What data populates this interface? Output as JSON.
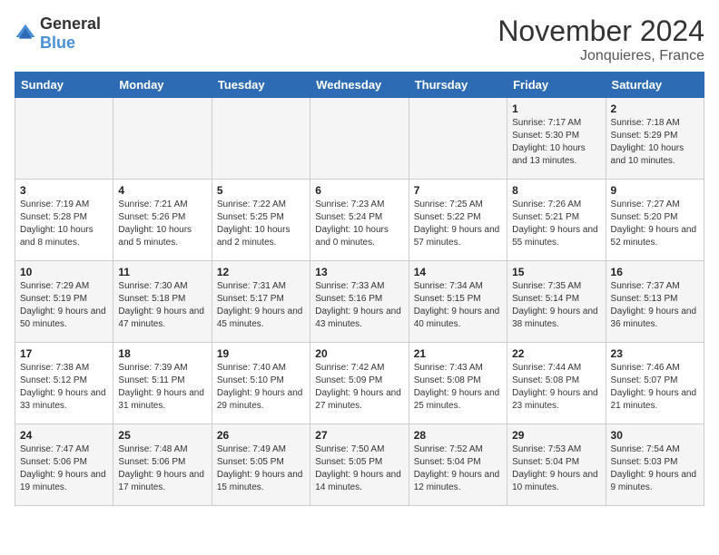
{
  "logo": {
    "general": "General",
    "blue": "Blue"
  },
  "header": {
    "month": "November 2024",
    "location": "Jonquieres, France"
  },
  "weekdays": [
    "Sunday",
    "Monday",
    "Tuesday",
    "Wednesday",
    "Thursday",
    "Friday",
    "Saturday"
  ],
  "weeks": [
    [
      {
        "day": "",
        "info": ""
      },
      {
        "day": "",
        "info": ""
      },
      {
        "day": "",
        "info": ""
      },
      {
        "day": "",
        "info": ""
      },
      {
        "day": "",
        "info": ""
      },
      {
        "day": "1",
        "info": "Sunrise: 7:17 AM\nSunset: 5:30 PM\nDaylight: 10 hours and 13 minutes."
      },
      {
        "day": "2",
        "info": "Sunrise: 7:18 AM\nSunset: 5:29 PM\nDaylight: 10 hours and 10 minutes."
      }
    ],
    [
      {
        "day": "3",
        "info": "Sunrise: 7:19 AM\nSunset: 5:28 PM\nDaylight: 10 hours and 8 minutes."
      },
      {
        "day": "4",
        "info": "Sunrise: 7:21 AM\nSunset: 5:26 PM\nDaylight: 10 hours and 5 minutes."
      },
      {
        "day": "5",
        "info": "Sunrise: 7:22 AM\nSunset: 5:25 PM\nDaylight: 10 hours and 2 minutes."
      },
      {
        "day": "6",
        "info": "Sunrise: 7:23 AM\nSunset: 5:24 PM\nDaylight: 10 hours and 0 minutes."
      },
      {
        "day": "7",
        "info": "Sunrise: 7:25 AM\nSunset: 5:22 PM\nDaylight: 9 hours and 57 minutes."
      },
      {
        "day": "8",
        "info": "Sunrise: 7:26 AM\nSunset: 5:21 PM\nDaylight: 9 hours and 55 minutes."
      },
      {
        "day": "9",
        "info": "Sunrise: 7:27 AM\nSunset: 5:20 PM\nDaylight: 9 hours and 52 minutes."
      }
    ],
    [
      {
        "day": "10",
        "info": "Sunrise: 7:29 AM\nSunset: 5:19 PM\nDaylight: 9 hours and 50 minutes."
      },
      {
        "day": "11",
        "info": "Sunrise: 7:30 AM\nSunset: 5:18 PM\nDaylight: 9 hours and 47 minutes."
      },
      {
        "day": "12",
        "info": "Sunrise: 7:31 AM\nSunset: 5:17 PM\nDaylight: 9 hours and 45 minutes."
      },
      {
        "day": "13",
        "info": "Sunrise: 7:33 AM\nSunset: 5:16 PM\nDaylight: 9 hours and 43 minutes."
      },
      {
        "day": "14",
        "info": "Sunrise: 7:34 AM\nSunset: 5:15 PM\nDaylight: 9 hours and 40 minutes."
      },
      {
        "day": "15",
        "info": "Sunrise: 7:35 AM\nSunset: 5:14 PM\nDaylight: 9 hours and 38 minutes."
      },
      {
        "day": "16",
        "info": "Sunrise: 7:37 AM\nSunset: 5:13 PM\nDaylight: 9 hours and 36 minutes."
      }
    ],
    [
      {
        "day": "17",
        "info": "Sunrise: 7:38 AM\nSunset: 5:12 PM\nDaylight: 9 hours and 33 minutes."
      },
      {
        "day": "18",
        "info": "Sunrise: 7:39 AM\nSunset: 5:11 PM\nDaylight: 9 hours and 31 minutes."
      },
      {
        "day": "19",
        "info": "Sunrise: 7:40 AM\nSunset: 5:10 PM\nDaylight: 9 hours and 29 minutes."
      },
      {
        "day": "20",
        "info": "Sunrise: 7:42 AM\nSunset: 5:09 PM\nDaylight: 9 hours and 27 minutes."
      },
      {
        "day": "21",
        "info": "Sunrise: 7:43 AM\nSunset: 5:08 PM\nDaylight: 9 hours and 25 minutes."
      },
      {
        "day": "22",
        "info": "Sunrise: 7:44 AM\nSunset: 5:08 PM\nDaylight: 9 hours and 23 minutes."
      },
      {
        "day": "23",
        "info": "Sunrise: 7:46 AM\nSunset: 5:07 PM\nDaylight: 9 hours and 21 minutes."
      }
    ],
    [
      {
        "day": "24",
        "info": "Sunrise: 7:47 AM\nSunset: 5:06 PM\nDaylight: 9 hours and 19 minutes."
      },
      {
        "day": "25",
        "info": "Sunrise: 7:48 AM\nSunset: 5:06 PM\nDaylight: 9 hours and 17 minutes."
      },
      {
        "day": "26",
        "info": "Sunrise: 7:49 AM\nSunset: 5:05 PM\nDaylight: 9 hours and 15 minutes."
      },
      {
        "day": "27",
        "info": "Sunrise: 7:50 AM\nSunset: 5:05 PM\nDaylight: 9 hours and 14 minutes."
      },
      {
        "day": "28",
        "info": "Sunrise: 7:52 AM\nSunset: 5:04 PM\nDaylight: 9 hours and 12 minutes."
      },
      {
        "day": "29",
        "info": "Sunrise: 7:53 AM\nSunset: 5:04 PM\nDaylight: 9 hours and 10 minutes."
      },
      {
        "day": "30",
        "info": "Sunrise: 7:54 AM\nSunset: 5:03 PM\nDaylight: 9 hours and 9 minutes."
      }
    ]
  ]
}
